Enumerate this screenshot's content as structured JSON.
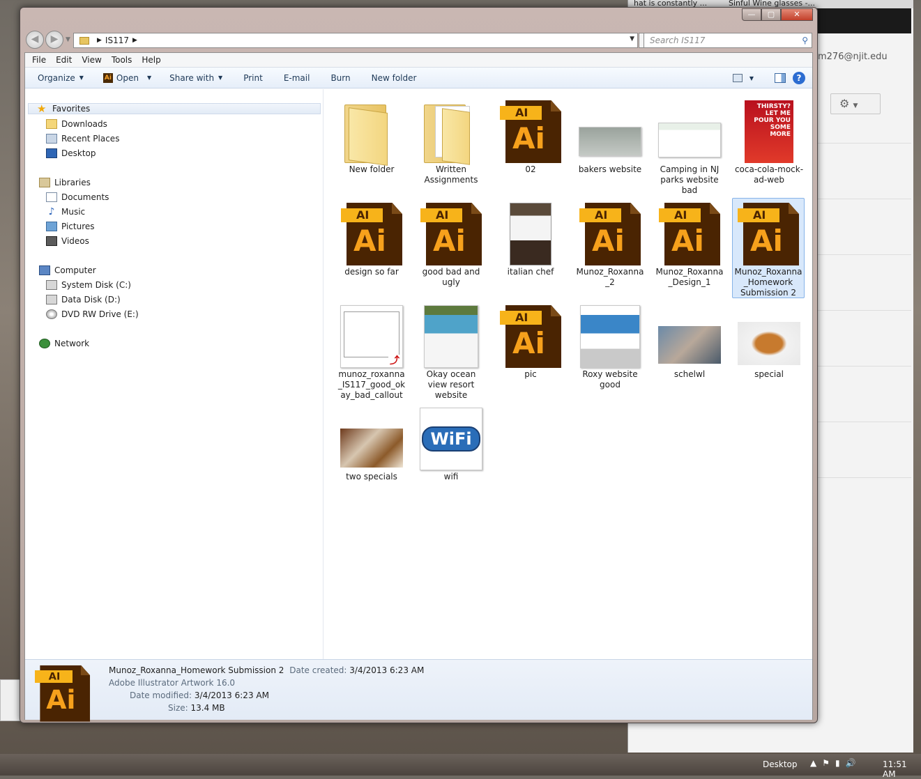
{
  "background_window": {
    "tabs": [
      "hat is constantly ...",
      "Sinful Wine glasses -..."
    ],
    "email_fragment": "m276@njit.edu",
    "gear_label": "⚙"
  },
  "window": {
    "caption": {
      "minimize": "—",
      "maximize": "▢",
      "close": "✕"
    },
    "address": {
      "path": "IS117",
      "search_placeholder": "Search IS117"
    },
    "menu": [
      "File",
      "Edit",
      "View",
      "Tools",
      "Help"
    ],
    "toolbar": {
      "organize": "Organize",
      "open": "Open",
      "share_with": "Share with",
      "print": "Print",
      "email": "E-mail",
      "burn": "Burn",
      "new_folder": "New folder"
    }
  },
  "nav": {
    "favorites": "Favorites",
    "downloads": "Downloads",
    "recent_places": "Recent Places",
    "desktop": "Desktop",
    "libraries": "Libraries",
    "documents": "Documents",
    "music": "Music",
    "pictures": "Pictures",
    "videos": "Videos",
    "computer": "Computer",
    "system_disk": "System Disk (C:)",
    "data_disk": "Data Disk (D:)",
    "dvd": "DVD RW Drive (E:)",
    "network": "Network"
  },
  "files": [
    {
      "label": "New folder",
      "type": "folder"
    },
    {
      "label": "Written Assignments",
      "type": "folder-docs"
    },
    {
      "label": "02",
      "type": "ai"
    },
    {
      "label": "bakers website",
      "type": "screenshot"
    },
    {
      "label": "Camping in NJ parks website bad",
      "type": "screenshot"
    },
    {
      "label": "coca-cola-mock-ad-web",
      "type": "poster"
    },
    {
      "label": "design so far",
      "type": "ai"
    },
    {
      "label": "good bad and ugly",
      "type": "ai"
    },
    {
      "label": "italian chef",
      "type": "photo"
    },
    {
      "label": "Munoz_Roxanna_2",
      "type": "ai"
    },
    {
      "label": "Munoz_Roxanna_Design_1",
      "type": "ai"
    },
    {
      "label": "Munoz_Roxanna_Homework Submission 2",
      "type": "ai",
      "selected": true
    },
    {
      "label": "munoz_roxanna_IS117_good_okay_bad_callout",
      "type": "pdf"
    },
    {
      "label": "Okay ocean view resort website",
      "type": "screenshot"
    },
    {
      "label": "pic",
      "type": "ai"
    },
    {
      "label": "Roxy website good",
      "type": "screenshot"
    },
    {
      "label": "schelwl",
      "type": "photo"
    },
    {
      "label": "special",
      "type": "photo"
    },
    {
      "label": "two specials",
      "type": "photo"
    },
    {
      "label": "wifi",
      "type": "logo"
    }
  ],
  "poster_text": "THIRSTY? LET ME POUR YOU SOME MORE",
  "wifi_text": "WiFi",
  "ai_badge": "AI",
  "ai_big": "Ai",
  "details": {
    "name": "Munoz_Roxanna_Homework Submission 2",
    "date_created_label": "Date created:",
    "date_created": "3/4/2013 6:23 AM",
    "type": "Adobe Illustrator Artwork 16.0",
    "date_modified_label": "Date modified:",
    "date_modified": "3/4/2013 6:23 AM",
    "size_label": "Size:",
    "size": "13.4 MB"
  },
  "taskbar": {
    "desktop": "Desktop",
    "time": "11:51 AM"
  },
  "colors": {
    "ai_brown": "#4a2402",
    "ai_orange": "#f7a11c",
    "selection": "#d8e8fb"
  }
}
